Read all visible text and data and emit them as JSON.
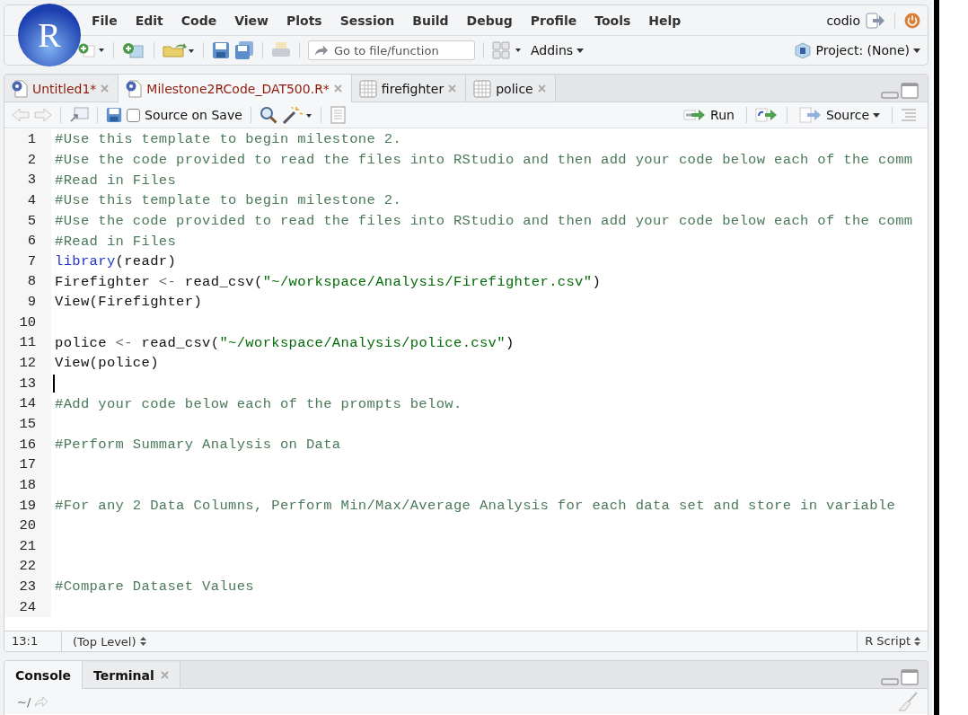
{
  "logo": "R",
  "menu": [
    "File",
    "Edit",
    "Code",
    "View",
    "Plots",
    "Session",
    "Build",
    "Debug",
    "Profile",
    "Tools",
    "Help"
  ],
  "user": "codio",
  "toolbar": {
    "goto_placeholder": "Go to file/function",
    "addins": "Addins",
    "project": "Project: (None)"
  },
  "source_tabs": [
    {
      "kind": "script",
      "label": "Untitled1*",
      "selected": false
    },
    {
      "kind": "script",
      "label": "Milestone2RCode_DAT500.R*",
      "selected": true
    },
    {
      "kind": "data",
      "label": "firefighter",
      "selected": false
    },
    {
      "kind": "data",
      "label": "police",
      "selected": false
    }
  ],
  "editor_toolbar": {
    "source_on_save": {
      "label": "Source on Save",
      "checked": false
    },
    "run": "Run",
    "source": "Source"
  },
  "code_lines": [
    {
      "number": "1",
      "tokens": [
        {
          "kind": "comment",
          "text": "#Use this template to begin milestone 2."
        }
      ]
    },
    {
      "number": "2",
      "tokens": [
        {
          "kind": "comment",
          "text": "#Use the code provided to read the files into RStudio and then add your code below each of the comm"
        }
      ]
    },
    {
      "number": "3",
      "tokens": [
        {
          "kind": "comment",
          "text": "#Read in Files"
        }
      ]
    },
    {
      "number": "4",
      "tokens": [
        {
          "kind": "comment",
          "text": "#Use this template to begin milestone 2."
        }
      ]
    },
    {
      "number": "5",
      "tokens": [
        {
          "kind": "comment",
          "text": "#Use the code provided to read the files into RStudio and then add your code below each of the comm"
        }
      ]
    },
    {
      "number": "6",
      "tokens": [
        {
          "kind": "comment",
          "text": "#Read in Files"
        }
      ]
    },
    {
      "number": "7",
      "tokens": [
        {
          "kind": "keyword",
          "text": "library"
        },
        {
          "kind": "plain",
          "text": "(readr)"
        }
      ]
    },
    {
      "number": "8",
      "tokens": [
        {
          "kind": "plain",
          "text": "Firefighter "
        },
        {
          "kind": "operator",
          "text": "<-"
        },
        {
          "kind": "plain",
          "text": " read_csv("
        },
        {
          "kind": "string",
          "text": "\"~/workspace/Analysis/Firefighter.csv\""
        },
        {
          "kind": "plain",
          "text": ")"
        }
      ]
    },
    {
      "number": "9",
      "tokens": [
        {
          "kind": "plain",
          "text": "View(Firefighter)"
        }
      ]
    },
    {
      "number": "10"
    },
    {
      "number": "11",
      "tokens": [
        {
          "kind": "plain",
          "text": "police "
        },
        {
          "kind": "operator",
          "text": "<-"
        },
        {
          "kind": "plain",
          "text": " read_csv("
        },
        {
          "kind": "string",
          "text": "\"~/workspace/Analysis/police.csv\""
        },
        {
          "kind": "plain",
          "text": ")"
        }
      ]
    },
    {
      "number": "12",
      "tokens": [
        {
          "kind": "plain",
          "text": "View(police)"
        }
      ]
    },
    {
      "number": "13",
      "cursor": true
    },
    {
      "number": "14",
      "tokens": [
        {
          "kind": "comment",
          "text": "#Add your code below each of the prompts below."
        }
      ]
    },
    {
      "number": "15"
    },
    {
      "number": "16",
      "tokens": [
        {
          "kind": "comment",
          "text": "#Perform Summary Analysis on Data"
        }
      ]
    },
    {
      "number": "17"
    },
    {
      "number": "18"
    },
    {
      "number": "19",
      "tokens": [
        {
          "kind": "comment",
          "text": "#For any 2 Data Columns, Perform Min/Max/Average Analysis for each data set and store in variable"
        }
      ]
    },
    {
      "number": "20"
    },
    {
      "number": "21"
    },
    {
      "number": "22"
    },
    {
      "number": "23",
      "tokens": [
        {
          "kind": "comment",
          "text": "#Compare Dataset Values"
        }
      ]
    },
    {
      "number": "24"
    }
  ],
  "status_bar": {
    "position": "13:1",
    "scope": "(Top Level)",
    "file_type": "R Script"
  },
  "console_tabs": [
    {
      "label": "Console",
      "selected": true,
      "closable": false
    },
    {
      "label": "Terminal",
      "selected": false,
      "closable": true
    }
  ],
  "console": {
    "path": "~/"
  }
}
